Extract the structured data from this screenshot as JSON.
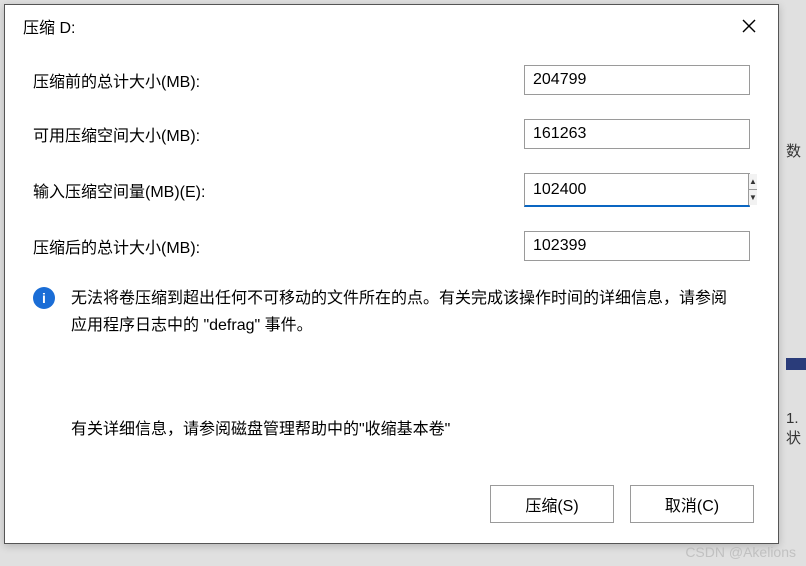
{
  "dialog": {
    "title": "压缩 D:",
    "rows": {
      "before_label": "压缩前的总计大小(MB):",
      "before_value": "204799",
      "avail_label": "可用压缩空间大小(MB):",
      "avail_value": "161263",
      "input_label": "输入压缩空间量(MB)(E):",
      "input_value": "102400",
      "after_label": "压缩后的总计大小(MB):",
      "after_value": "102399"
    },
    "info": "无法将卷压缩到超出任何不可移动的文件所在的点。有关完成该操作时间的详细信息，请参阅应用程序日志中的 \"defrag\" 事件。",
    "info2": "有关详细信息，请参阅磁盘管理帮助中的\"收缩基本卷\"",
    "buttons": {
      "shrink": "压缩(S)",
      "cancel": "取消(C)"
    }
  },
  "bg": {
    "text1": "数",
    "text2a": "1.",
    "text2b": "状"
  },
  "watermark": "CSDN @Akelions"
}
